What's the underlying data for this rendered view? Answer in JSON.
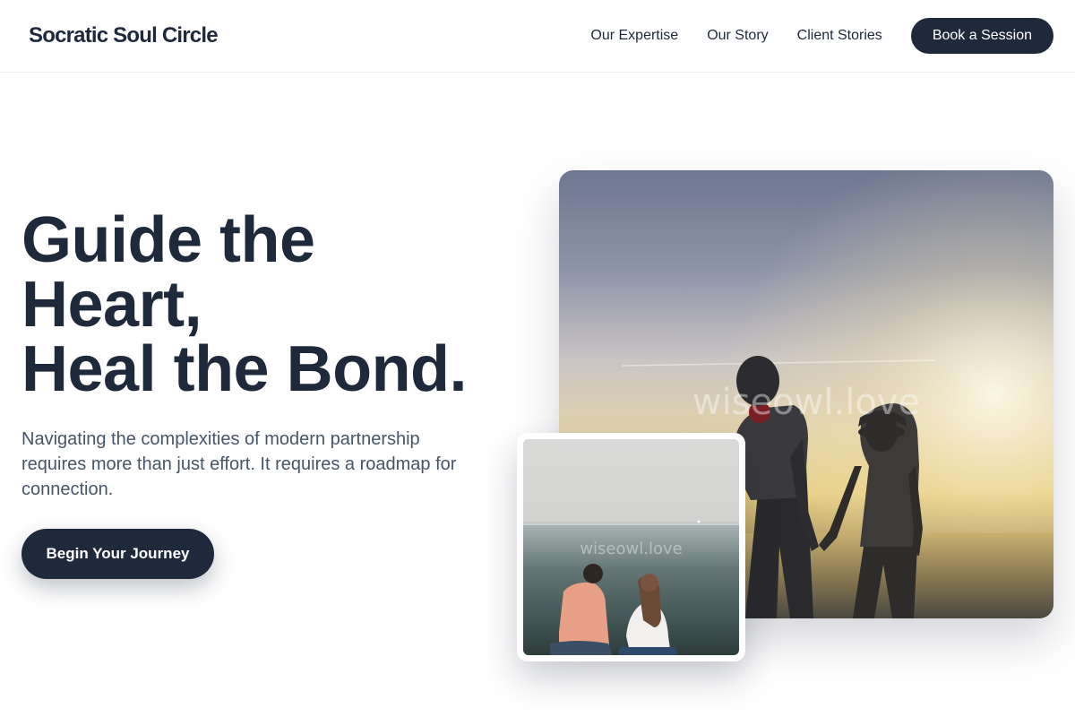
{
  "nav": {
    "brand": "Socratic Soul Circle",
    "links": [
      "Our Expertise",
      "Our Story",
      "Client Stories"
    ],
    "cta": "Book a Session"
  },
  "hero": {
    "headline_lines": [
      "Guide the",
      "Heart,",
      "Heal the Bond."
    ],
    "subtext": "Navigating the complexities of modern partnership requires more than just effort. It requires a roadmap for connection.",
    "cta": "Begin Your Journey"
  },
  "images": {
    "main_watermark": "wiseowl.love",
    "small_watermark": "wiseowl.love"
  },
  "colors": {
    "primary": "#1e293b",
    "body_text": "#475569",
    "background": "#ffffff"
  }
}
